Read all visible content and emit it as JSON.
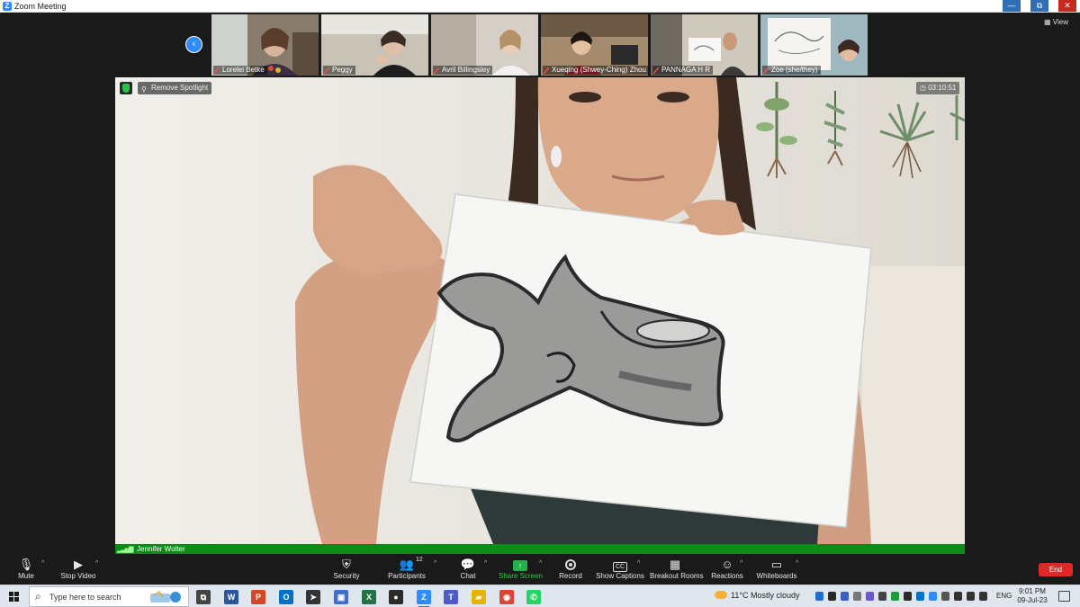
{
  "window": {
    "title": "Zoom Meeting",
    "controls": [
      "—",
      "⧉",
      "✕"
    ],
    "app_icon": "Z"
  },
  "gallery": {
    "view_label": "View",
    "participants": [
      {
        "name": "Lorelei Betke"
      },
      {
        "name": "Peggy"
      },
      {
        "name": "Avril Billingsley"
      },
      {
        "name": "Xueqing (Shwey-Ching) Zhou"
      },
      {
        "name": "PANNAGA H R"
      },
      {
        "name": "Zoe (she/they)"
      }
    ]
  },
  "spotlight": {
    "remove_label": "Remove Spotlight",
    "recording_time": "03:10:51",
    "speaker_name": "Jennifer Wolter"
  },
  "toolbar": {
    "participants_count": "12",
    "end_label": "End",
    "items": [
      {
        "label": "Mute",
        "icon": "microphone-icon"
      },
      {
        "label": "Stop Video",
        "icon": "camera-icon"
      },
      {
        "label": "Security",
        "icon": "shield-icon"
      },
      {
        "label": "Participants",
        "icon": "people-icon"
      },
      {
        "label": "Chat",
        "icon": "chat-icon"
      },
      {
        "label": "Share Screen",
        "icon": "share-icon"
      },
      {
        "label": "Record",
        "icon": "record-icon"
      },
      {
        "label": "Show Captions",
        "icon": "cc-icon"
      },
      {
        "label": "Breakout Rooms",
        "icon": "grid-icon"
      },
      {
        "label": "Reactions",
        "icon": "smiley-icon"
      },
      {
        "label": "Whiteboards",
        "icon": "whiteboard-icon"
      }
    ],
    "share_color": "#22b14c",
    "end_color": "#e02828"
  },
  "taskbar": {
    "search_placeholder": "Type here to search",
    "weather": "11°C  Mostly cloudy",
    "language": "ENG",
    "time": "9:01 PM",
    "date": "09-Jul-23",
    "apps": [
      {
        "name": "task-view",
        "glyph": "⧉",
        "color": "#444444"
      },
      {
        "name": "word",
        "glyph": "W",
        "color": "#2b579a"
      },
      {
        "name": "powerpoint",
        "glyph": "P",
        "color": "#d24726"
      },
      {
        "name": "outlook",
        "glyph": "O",
        "color": "#0072c6"
      },
      {
        "name": "cursor-app",
        "glyph": "➤",
        "color": "#333333"
      },
      {
        "name": "remote-desktop",
        "glyph": "▣",
        "color": "#3b6fc9"
      },
      {
        "name": "excel",
        "glyph": "X",
        "color": "#217346"
      },
      {
        "name": "obs",
        "glyph": "●",
        "color": "#2b2b2b"
      },
      {
        "name": "zoom",
        "glyph": "Z",
        "color": "#2d8cff"
      },
      {
        "name": "teams",
        "glyph": "T",
        "color": "#5059c9"
      },
      {
        "name": "file-explorer",
        "glyph": "▰",
        "color": "#e6b400"
      },
      {
        "name": "chrome",
        "glyph": "◉",
        "color": "#db4437"
      },
      {
        "name": "whatsapp",
        "glyph": "✆",
        "color": "#25d366"
      }
    ]
  }
}
